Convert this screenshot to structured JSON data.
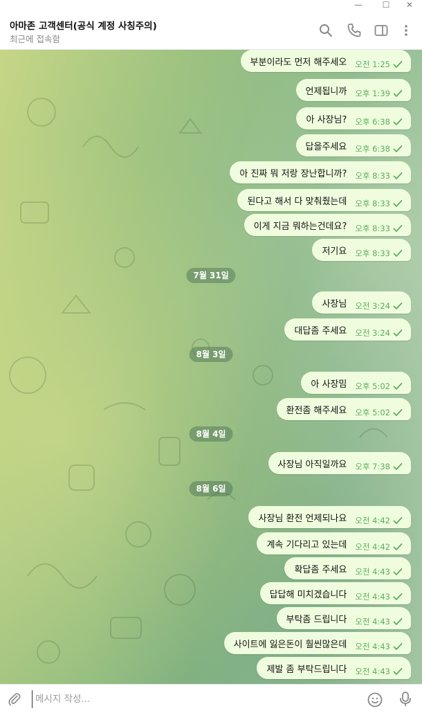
{
  "window": {
    "min_glyph": "—",
    "max_glyph": "☐",
    "close_glyph": "✕"
  },
  "header": {
    "title": "아마존 고객센터(공식 계정 사칭주의)",
    "status": "최근에 접속함",
    "icons": [
      "search-icon",
      "phone-icon",
      "sidebar-icon",
      "more-vertical-icon"
    ]
  },
  "messages": [
    {
      "text": "부분이라도 먼저 해주세오",
      "time": "오전 1:25"
    },
    {
      "text": "언제됩니까",
      "time": "오후 1:39"
    },
    {
      "text": "아 사장님?",
      "time": "오후 6:38"
    },
    {
      "text": "답을주세요",
      "time": "오후 6:38"
    },
    {
      "text": "아 진짜 뭐 저랑 장난합니까?",
      "time": "오후 8:33"
    },
    {
      "text": "된다고 해서 다 맞춰줬는데",
      "time": "오후 8:33"
    },
    {
      "text": "이게 지금 뭐하는건데요?",
      "time": "오후 8:33"
    },
    {
      "text": "저기요",
      "time": "오후 8:33"
    },
    {
      "date": "7월 31일"
    },
    {
      "text": "사장님",
      "time": "오전 3:24"
    },
    {
      "text": "대답좀 주세요",
      "time": "오전 3:24"
    },
    {
      "date": "8월 3일"
    },
    {
      "text": "아 사장밈",
      "time": "오후 5:02"
    },
    {
      "text": "환전좀 해주세요",
      "time": "오후 5:02"
    },
    {
      "date": "8월 4일"
    },
    {
      "text": "사장님 아직일까요",
      "time": "오후 7:38"
    },
    {
      "date": "8월 6일"
    },
    {
      "text": "사장님 환전 언제되나요",
      "time": "오전 4:42"
    },
    {
      "text": "계속 기다리고 있는데",
      "time": "오전 4:42"
    },
    {
      "text": "확답좀 주세요",
      "time": "오전 4:43"
    },
    {
      "text": "답답해 미치겠습니다",
      "time": "오전 4:43"
    },
    {
      "text": "부탁좀 드립니다",
      "time": "오전 4:43"
    },
    {
      "text": "사이트에 잃은돈이 훨씬많은데",
      "time": "오전 4:43"
    },
    {
      "text": "제발 좀 부탁드립니다",
      "time": "오전 4:43"
    }
  ],
  "composer": {
    "placeholder": "메시지 작성...",
    "icons": [
      "attach-icon",
      "emoji-icon",
      "microphone-icon"
    ]
  },
  "colors": {
    "bubble_out": "#effdde",
    "time_green": "#5cad5c",
    "date_pill": "#6f9478"
  }
}
